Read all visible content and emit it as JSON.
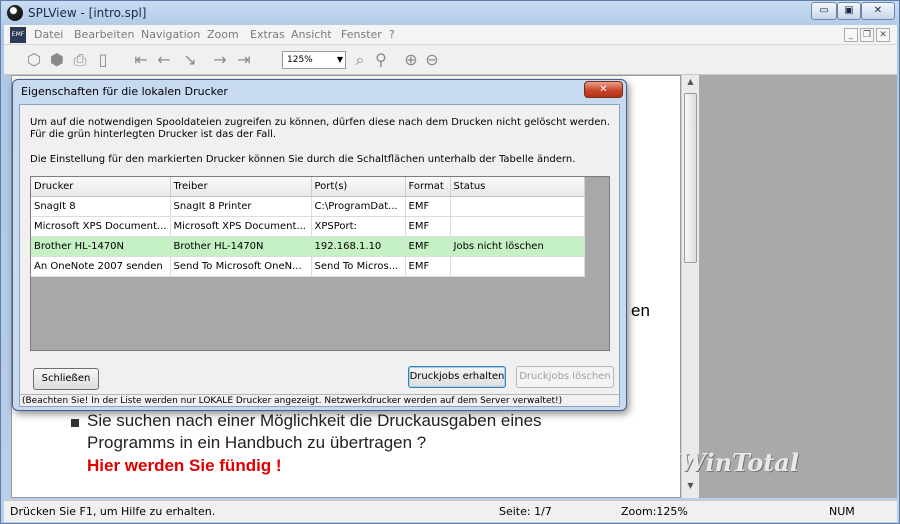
{
  "window": {
    "title": "SPLView - [intro.spl]",
    "caption_minimize": "▭",
    "caption_maximize": "▣",
    "caption_close": "✕"
  },
  "menubar": {
    "doc_icon_label": "EMF",
    "items": [
      "Datei",
      "Bearbeiten",
      "Navigation",
      "Zoom",
      "Extras",
      "Ansicht",
      "Fenster",
      "?"
    ],
    "mdi_minimize": "_",
    "mdi_restore": "❐",
    "mdi_close": "✕"
  },
  "toolbar": {
    "zoom_value": "125%",
    "icons": [
      "open-icon",
      "print-icon",
      "print-setup-icon",
      "page-icon",
      "first-page-icon",
      "prev-page-icon",
      "goto-page-icon",
      "next-page-icon",
      "last-page-icon",
      "zoom-fit-icon",
      "zoom-100-icon",
      "zoom-in-icon",
      "zoom-out-icon"
    ]
  },
  "document": {
    "fragment": "en",
    "line1": "Sie suchen nach einer Möglichkeit die Druckausgaben eines",
    "line2": "Programms in ein Handbuch zu übertragen ?",
    "line3": "Hier werden Sie fündig !",
    "highlight_color": "#e00000",
    "watermark": "WinTotal"
  },
  "dialog": {
    "title": "Eigenschaften für die lokalen Drucker",
    "intro_text": "Um auf die notwendigen Spooldateien zugreifen zu können, dürfen diese nach dem Drucken nicht gelöscht werden. Für die grün hinterlegten Drucker ist das der Fall.",
    "instruction_text": "Die Einstellung für den markierten Drucker können Sie durch die Schaltflächen unterhalb der Tabelle ändern.",
    "columns": [
      "Drucker",
      "Treiber",
      "Port(s)",
      "Format",
      "Status"
    ],
    "rows": [
      [
        "SnagIt 8",
        "SnagIt 8 Printer",
        "C:\\ProgramDat...",
        "EMF",
        ""
      ],
      [
        "Microsoft XPS Document...",
        "Microsoft XPS Document...",
        "XPSPort:",
        "EMF",
        ""
      ],
      [
        "Brother HL-1470N",
        "Brother HL-1470N",
        "192.168.1.10",
        "EMF",
        "Jobs nicht löschen"
      ],
      [
        "An OneNote 2007 senden",
        "Send To Microsoft OneN...",
        "Send To Micros...",
        "EMF",
        ""
      ]
    ],
    "selected_row_color": "#c5f1c5",
    "close_button": "Schließen",
    "keep_jobs_button": "Druckjobs erhalten",
    "delete_jobs_button": "Druckjobs löschen",
    "footer_note": "(Beachten Sie! In der Liste werden nur LOKALE Drucker angezeigt. Netzwerkdrucker werden auf dem Server verwaltet!)"
  },
  "statusbar": {
    "help": "Drücken Sie F1, um Hilfe zu erhalten.",
    "page": "Seite: 1/7",
    "zoom": "Zoom:125%",
    "num": "NUM"
  }
}
